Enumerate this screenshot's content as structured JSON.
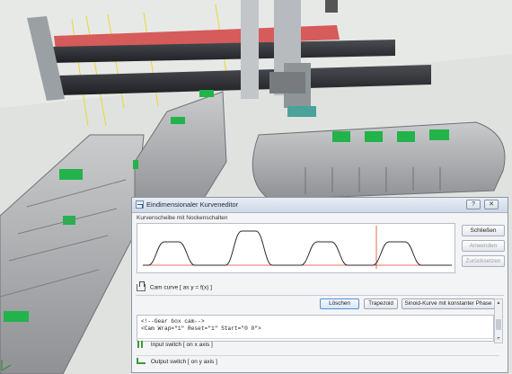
{
  "dialog": {
    "title": "Eindimensionaler Kurveneditor",
    "help_glyph": "?",
    "close_glyph": "✕",
    "subtitle": "Kurvenscheibe mit Nockenschalten",
    "side_buttons": [
      "Schließen",
      "Anwenden",
      "Zurücksetzen"
    ],
    "cam_curve_label": "Cam curve [ as y = f(x) ]",
    "buttons": [
      "Löschen",
      "Trapezoid",
      "Sinoid-Kurve mit konstanter Phase"
    ],
    "code_lines": [
      "<!--Gear box cam-->",
      "<Cam Wrap=\"1\" Reset=\"1\" Start=\"0 0\">"
    ],
    "input_switch_label": "Input switch [ on x axis ]",
    "output_switch_label": "Output switch [ on y axis ]"
  },
  "colors": {
    "curve": "#2b2b2b",
    "marker": "#e0432b",
    "belt_pad": "#22b34a",
    "rail_top": "#d65b5b"
  },
  "icons": [
    "app-icon",
    "help-icon",
    "close-icon",
    "cam-curve-icon",
    "input-switch-icon",
    "output-switch-icon"
  ]
}
